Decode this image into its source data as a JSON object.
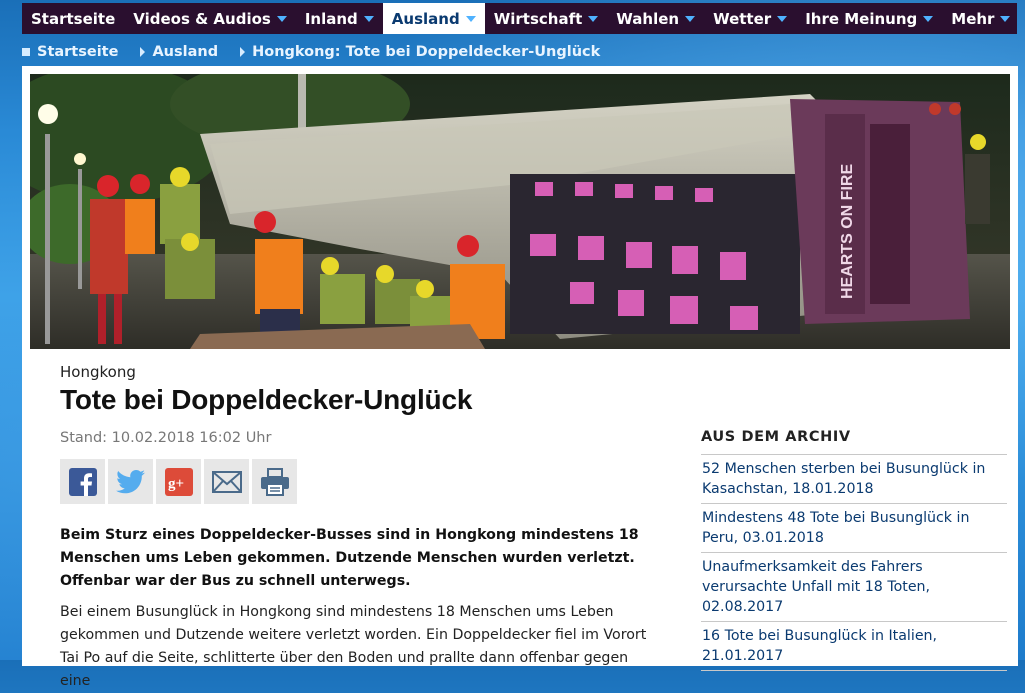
{
  "nav": {
    "items": [
      {
        "label": "Startseite",
        "caret": false,
        "active": false
      },
      {
        "label": "Videos & Audios",
        "caret": true,
        "active": false
      },
      {
        "label": "Inland",
        "caret": true,
        "active": false
      },
      {
        "label": "Ausland",
        "caret": true,
        "active": true
      },
      {
        "label": "Wirtschaft",
        "caret": true,
        "active": false
      },
      {
        "label": "Wahlen",
        "caret": true,
        "active": false
      },
      {
        "label": "Wetter",
        "caret": true,
        "active": false
      },
      {
        "label": "Ihre Meinung",
        "caret": true,
        "active": false
      },
      {
        "label": "Mehr",
        "caret": true,
        "active": false
      }
    ]
  },
  "breadcrumb": [
    "Startseite",
    "Ausland",
    "Hongkong: Tote bei Doppeldecker-Unglück"
  ],
  "hero": {
    "bus_ad_text": "HEARTS ON FIRE"
  },
  "article": {
    "kicker": "Hongkong",
    "headline": "Tote bei Doppeldecker-Unglück",
    "dateline": "Stand: 10.02.2018 16:02 Uhr",
    "lead": "Beim Sturz eines Doppeldecker-Busses sind in Hongkong mindestens 18 Menschen ums Leben gekommen. Dutzende Menschen wurden verletzt. Offenbar war der Bus zu schnell unterwegs.",
    "body": "Bei einem Busunglück in Hongkong sind mindestens 18 Menschen ums Leben gekommen und Dutzende weitere verletzt worden. Ein Doppeldecker fiel im Vorort Tai Po auf die Seite, schlitterte über den Boden und prallte dann offenbar gegen eine"
  },
  "share": [
    "facebook-icon",
    "twitter-icon",
    "googleplus-icon",
    "mail-icon",
    "print-icon"
  ],
  "share_colors": {
    "facebook": "#3b5998",
    "twitter": "#55acee",
    "googleplus": "#dd4b39",
    "mail": "#4a6a8a",
    "print": "#4a6a8a"
  },
  "archive": {
    "title": "AUS DEM ARCHIV",
    "items": [
      "52 Menschen sterben bei Busunglück in Kasachstan, 18.01.2018",
      "Mindestens 48 Tote bei Busunglück in Peru, 03.01.2018",
      "Unaufmerksamkeit des Fahrers verursachte Unfall mit 18 Toten, 02.08.2017",
      "16 Tote bei Busunglück in Italien, 21.01.2017"
    ]
  },
  "colors": {
    "nav_bg": "#2a0f2f",
    "accent": "#4fb2ff",
    "link": "#0a3a70"
  }
}
